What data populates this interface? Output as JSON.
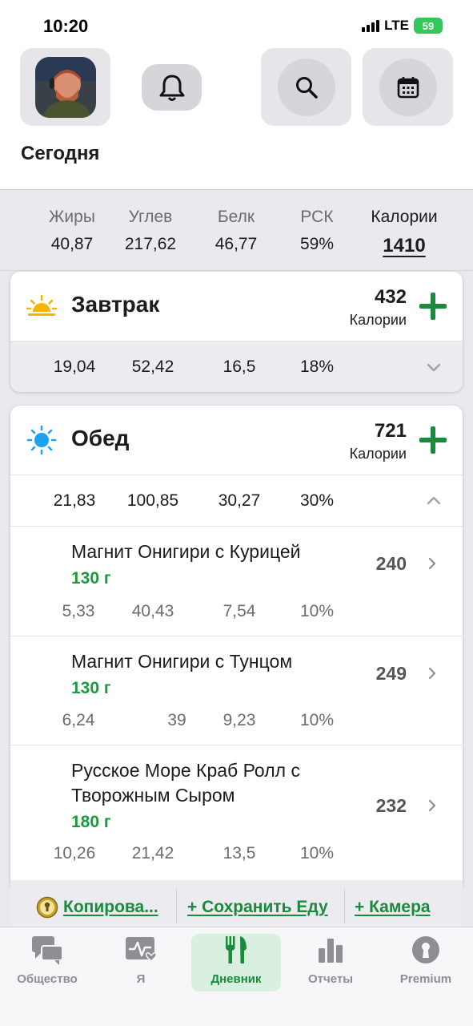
{
  "status_bar": {
    "time": "10:20",
    "network": "LTE",
    "battery": "59"
  },
  "header": {
    "title": "Сегодня"
  },
  "summary": {
    "fat_label": "Жиры",
    "fat": "40,87",
    "carbs_label": "Углев",
    "carbs": "217,62",
    "protein_label": "Белк",
    "protein": "46,77",
    "rdi_label": "РСК",
    "rdi": "59%",
    "calories_label": "Калории",
    "calories": "1410"
  },
  "breakfast": {
    "title": "Завтрак",
    "calories": "432",
    "calories_unit": "Калории",
    "fat": "19,04",
    "carbs": "52,42",
    "protein": "16,5",
    "rdi": "18%"
  },
  "lunch": {
    "title": "Обед",
    "calories": "721",
    "calories_unit": "Калории",
    "fat": "21,83",
    "carbs": "100,85",
    "protein": "30,27",
    "rdi": "30%",
    "items": [
      {
        "name": "Магнит Онигири с Курицей",
        "grams": "130 г",
        "kcal": "240",
        "fat": "5,33",
        "carbs": "40,43",
        "protein": "7,54",
        "rdi": "10%"
      },
      {
        "name": "Магнит Онигири с Тунцом",
        "grams": "130 г",
        "kcal": "249",
        "fat": "6,24",
        "carbs": "39",
        "protein": "9,23",
        "rdi": "10%"
      },
      {
        "name": "Русское Море Краб Ролл с Творожным Сыром",
        "grams": "180 г",
        "kcal": "232",
        "fat": "10,26",
        "carbs": "21,42",
        "protein": "13,5",
        "rdi": "10%"
      }
    ]
  },
  "actions": {
    "copy": "Копирова...",
    "save": "+ Сохранить Еду",
    "camera": "+ Камера"
  },
  "tabs": {
    "community": "Общество",
    "me": "Я",
    "diary": "Дневник",
    "reports": "Отчеты",
    "premium": "Premium"
  },
  "colors": {
    "accent": "#1a8a3c",
    "background_band": "#e9e9ee"
  }
}
